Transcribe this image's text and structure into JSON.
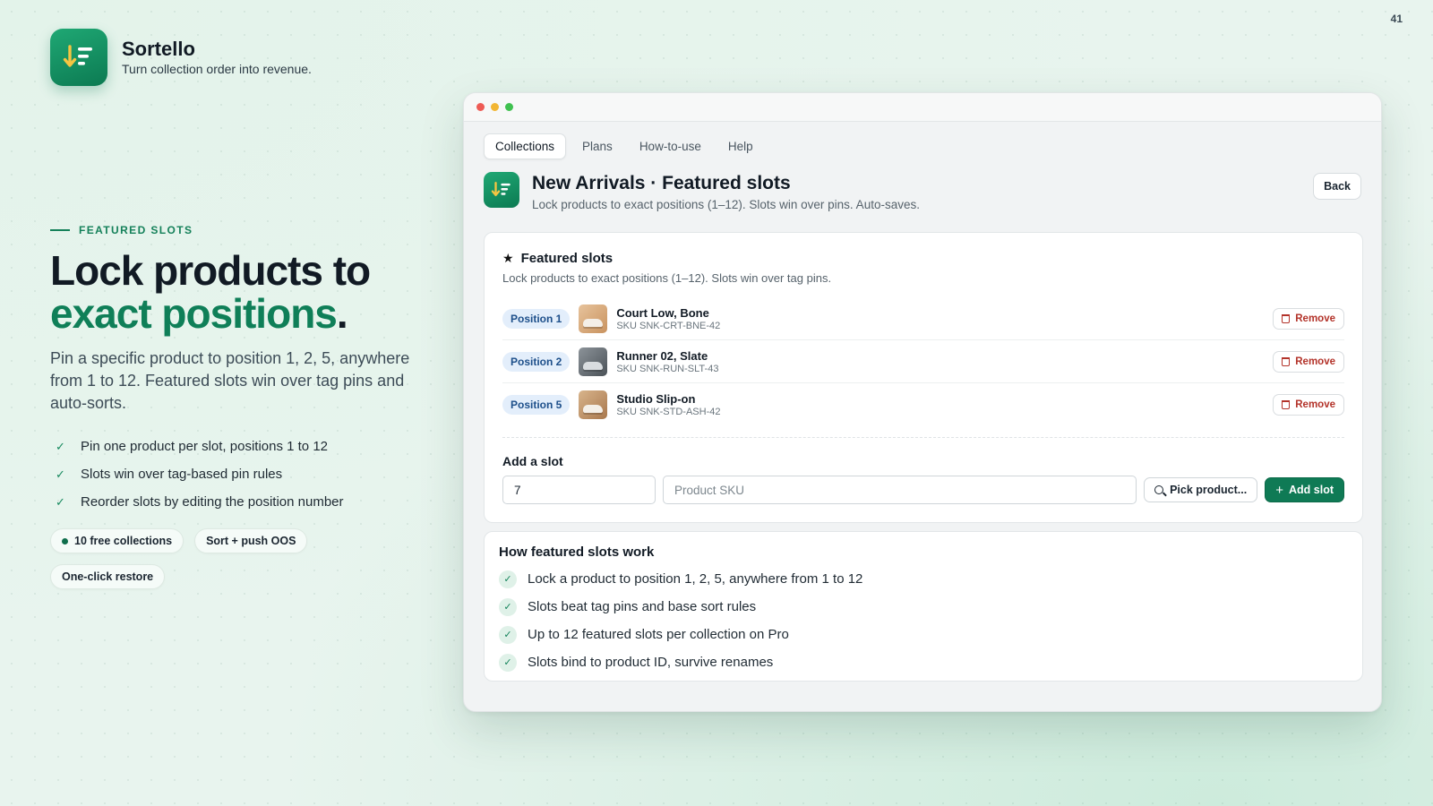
{
  "page_number": "41",
  "brand": {
    "name": "Sortello",
    "tagline": "Turn collection order into revenue.",
    "icon": "sort-down-list-icon",
    "accent_color": "#0f7a55"
  },
  "hero": {
    "eyebrow": "FEATURED SLOTS",
    "headline_line1": "Lock products to",
    "headline_accent": "exact positions",
    "headline_period": ".",
    "lede": "Pin a specific product to position 1, 2, 5, anywhere from 1 to 12. Featured slots win over tag pins and auto-sorts.",
    "bullets": [
      "Pin one product per slot, positions 1 to 12",
      "Slots win over tag-based pin rules",
      "Reorder slots by editing the position number"
    ],
    "pills": [
      "10 free collections",
      "Sort + push OOS",
      "One-click restore"
    ]
  },
  "app": {
    "tabs": [
      "Collections",
      "Plans",
      "How-to-use",
      "Help"
    ],
    "active_tab": "Collections",
    "title": "New Arrivals · Featured slots",
    "subtitle": "Lock products to exact positions (1–12). Slots win over pins. Auto-saves.",
    "back_label": "Back",
    "featured": {
      "title": "Featured slots",
      "subtitle": "Lock products to exact positions (1–12). Slots win over tag pins.",
      "remove_label": "Remove",
      "slots": [
        {
          "position": "Position 1",
          "name": "Court Low, Bone",
          "sku": "SKU SNK-CRT-BNE-42"
        },
        {
          "position": "Position 2",
          "name": "Runner 02, Slate",
          "sku": "SKU SNK-RUN-SLT-43"
        },
        {
          "position": "Position 5",
          "name": "Studio Slip-on",
          "sku": "SKU SNK-STD-ASH-42"
        }
      ]
    },
    "add_slot": {
      "label": "Add a slot",
      "position_value": "7",
      "sku_placeholder": "Product SKU",
      "pick_label": "Pick product...",
      "add_label": "Add slot"
    },
    "how": {
      "title": "How featured slots work",
      "items": [
        "Lock a product to position 1, 2, 5, anywhere from 1 to 12",
        "Slots beat tag pins and base sort rules",
        "Up to 12 featured slots per collection on Pro",
        "Slots bind to product ID, survive renames"
      ]
    }
  }
}
